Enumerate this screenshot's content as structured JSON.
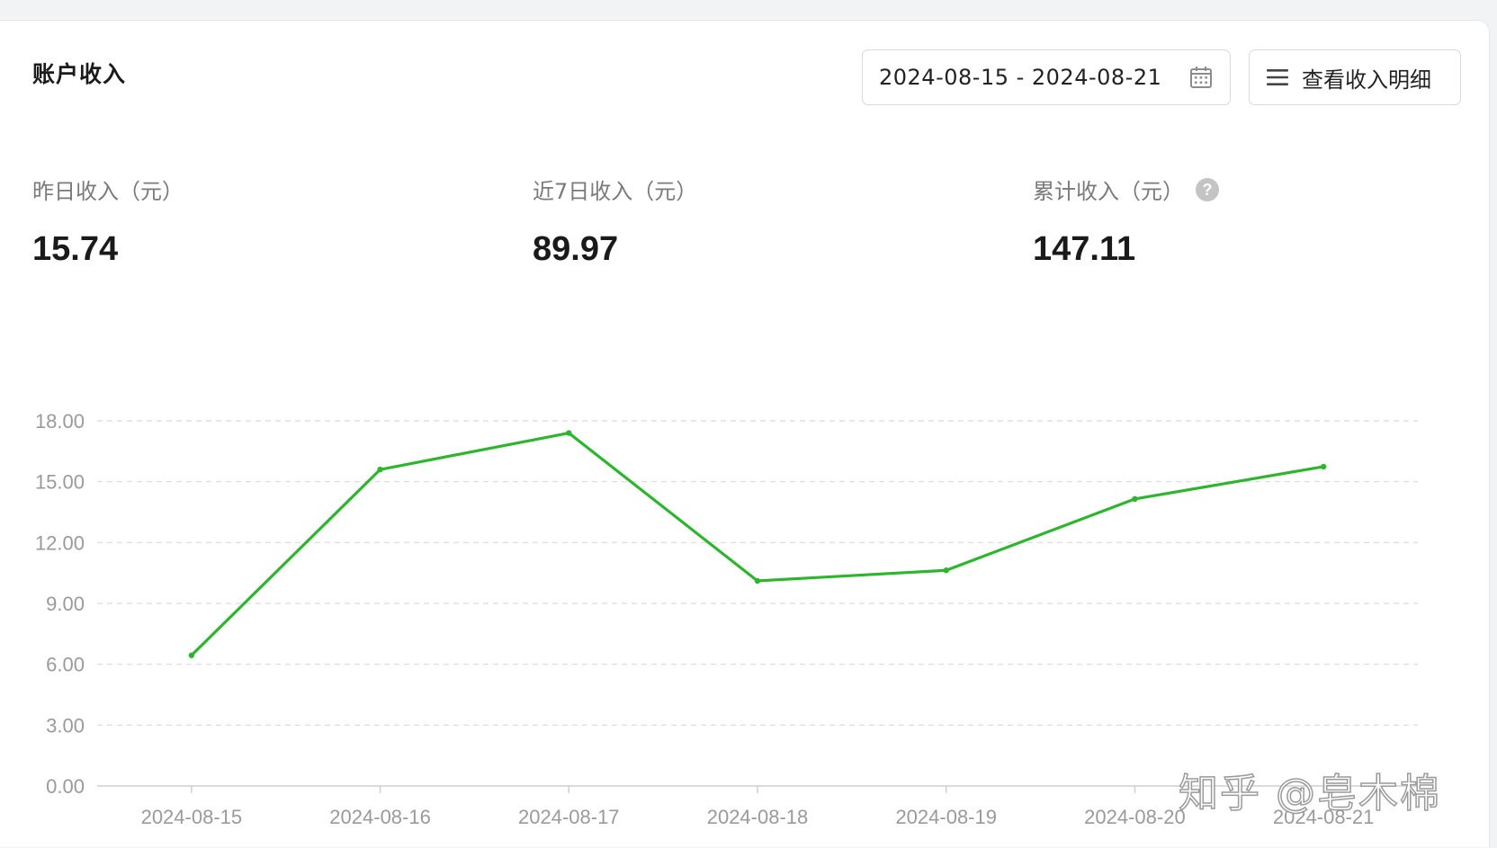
{
  "card": {
    "title": "账户收入"
  },
  "toolbar": {
    "date_range": "2024-08-15 - 2024-08-21",
    "calendar_icon": "calendar-icon",
    "detail_icon": "list-icon",
    "detail_label": "查看收入明细"
  },
  "stats": [
    {
      "label": "昨日收入（元）",
      "value": "15.74"
    },
    {
      "label": "近7日收入（元）",
      "value": "89.97"
    },
    {
      "label": "累计收入（元）",
      "value": "147.11",
      "icon": "help-icon"
    }
  ],
  "chart_data": {
    "type": "line",
    "categories": [
      "2024-08-15",
      "2024-08-16",
      "2024-08-17",
      "2024-08-18",
      "2024-08-19",
      "2024-08-20",
      "2024-08-21"
    ],
    "series": [
      {
        "values": [
          6.44,
          15.6,
          17.4,
          10.11,
          10.63,
          14.15,
          15.74
        ]
      }
    ],
    "yticks": [
      "0.00",
      "3.00",
      "6.00",
      "9.00",
      "12.00",
      "15.00",
      "18.00"
    ],
    "ylim": [
      0,
      18
    ],
    "grid": "horizontal-dashed",
    "line_color": "#2db52d",
    "grid_color": "#d9d9d9",
    "tick_color": "#9a9a9a"
  },
  "watermark": "知乎 @皂木棉"
}
